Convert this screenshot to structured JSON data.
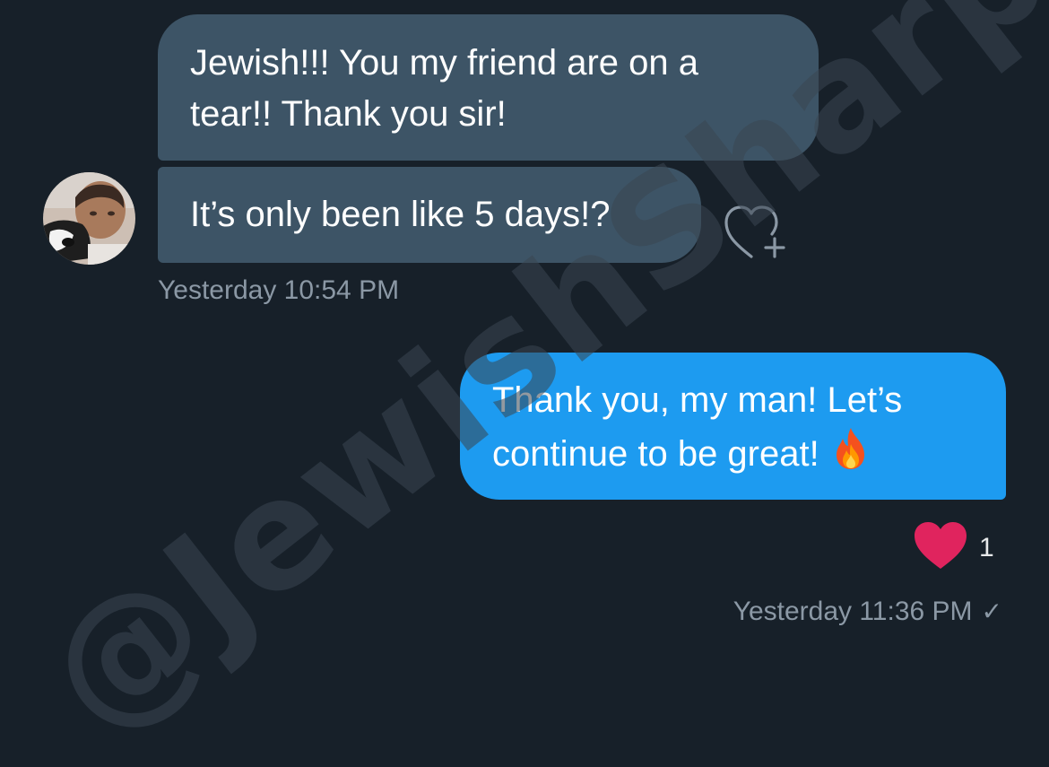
{
  "conversation": {
    "incoming": {
      "messages": [
        "Jewish!!! You my friend are on a tear!! Thank you sir!",
        "It’s only been like 5 days!?"
      ],
      "timestamp": "Yesterday 10:54 PM",
      "add_reaction_icon": "heart-plus-icon",
      "avatar_icon": "user-avatar"
    },
    "outgoing": {
      "message": "Thank you, my man! Let’s continue to be great!",
      "emoji_icon": "fire-emoji",
      "timestamp": "Yesterday 11:36 PM",
      "status_icon": "checkmark-icon",
      "status_glyph": "✓",
      "reaction": {
        "icon": "heart-icon",
        "count": "1"
      }
    }
  },
  "watermark": {
    "text": "@JewishSharp"
  },
  "colors": {
    "background": "#172029",
    "incoming_bubble": "#3d5466",
    "outgoing_bubble": "#1d9bf0",
    "reaction_heart": "#e0245e",
    "timestamp": "#8b98a5"
  }
}
